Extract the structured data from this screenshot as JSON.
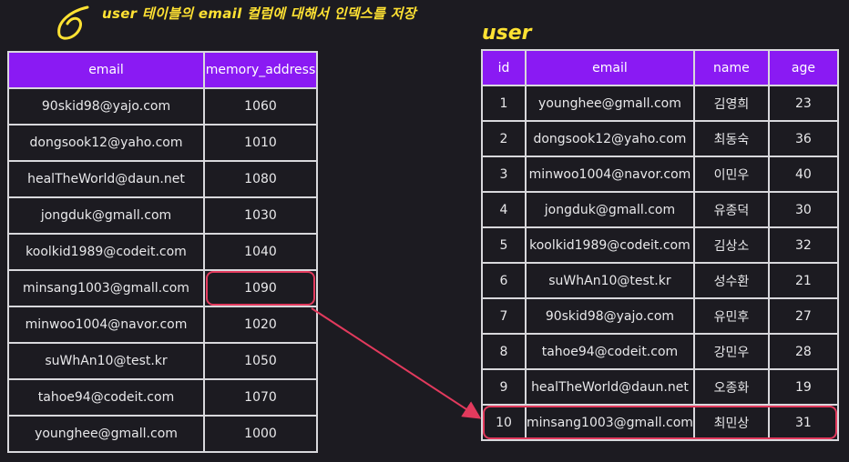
{
  "caption": "user 테이블의 email 컬럼에 대해서 인덱스를 저장",
  "index_table": {
    "headers": [
      "email",
      "memory_address"
    ],
    "rows": [
      [
        "90skid98@yajo.com",
        "1060"
      ],
      [
        "dongsook12@yaho.com",
        "1010"
      ],
      [
        "healTheWorld@daun.net",
        "1080"
      ],
      [
        "jongduk@gmall.com",
        "1030"
      ],
      [
        "koolkid1989@codeit.com",
        "1040"
      ],
      [
        "minsang1003@gmall.com",
        "1090"
      ],
      [
        "minwoo1004@navor.com",
        "1020"
      ],
      [
        "suWhAn10@test.kr",
        "1050"
      ],
      [
        "tahoe94@codeit.com",
        "1070"
      ],
      [
        "younghee@gmall.com",
        "1000"
      ]
    ],
    "highlighted_row": 5
  },
  "user_table": {
    "title": "user",
    "headers": [
      "id",
      "email",
      "name",
      "age"
    ],
    "rows": [
      [
        "1",
        "younghee@gmall.com",
        "김영희",
        "23"
      ],
      [
        "2",
        "dongsook12@yaho.com",
        "최동숙",
        "36"
      ],
      [
        "3",
        "minwoo1004@navor.com",
        "이민우",
        "40"
      ],
      [
        "4",
        "jongduk@gmall.com",
        "유종덕",
        "30"
      ],
      [
        "5",
        "koolkid1989@codeit.com",
        "김상소",
        "32"
      ],
      [
        "6",
        "suWhAn10@test.kr",
        "성수환",
        "21"
      ],
      [
        "7",
        "90skid98@yajo.com",
        "유민후",
        "27"
      ],
      [
        "8",
        "tahoe94@codeit.com",
        "강민우",
        "28"
      ],
      [
        "9",
        "healTheWorld@daun.net",
        "오종화",
        "19"
      ],
      [
        "10",
        "minsang1003@gmall.com",
        "최민상",
        "31"
      ]
    ],
    "highlighted_row": 9
  },
  "colors": {
    "background": "#1c1b21",
    "header": "#8a1af3",
    "highlight": "#e23a5d",
    "annotation": "#ffe233"
  },
  "icons": {
    "caption_mark": "hand-drawn-note-icon"
  }
}
